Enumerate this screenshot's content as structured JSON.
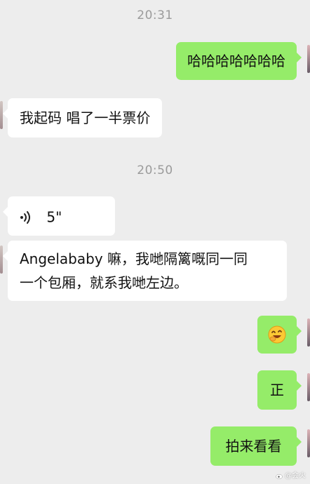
{
  "chat": {
    "timestamps": [
      "20:31",
      "20:50"
    ],
    "messages": [
      {
        "from": "me",
        "type": "text",
        "text": "哈哈哈哈哈哈哈"
      },
      {
        "from": "other",
        "type": "text",
        "text": "我起码 唱了一半票价"
      },
      {
        "from": "other",
        "type": "voice",
        "duration": "5\""
      },
      {
        "from": "other",
        "type": "text",
        "lines": [
          "Angelababy 嘛，我哋隔篱嘅同一同",
          "一个包厢，就系我哋左边。"
        ]
      },
      {
        "from": "me",
        "type": "emoji",
        "icon": "laughing-face-emoji"
      },
      {
        "from": "me",
        "type": "text",
        "text": "正"
      },
      {
        "from": "me",
        "type": "text",
        "text": "拍来看看"
      }
    ]
  },
  "colors": {
    "background": "#ededed",
    "my_bubble": "#95ec69",
    "their_bubble": "#ffffff",
    "timestamp": "#9b9b9b"
  },
  "watermark": {
    "text": "@会火"
  }
}
